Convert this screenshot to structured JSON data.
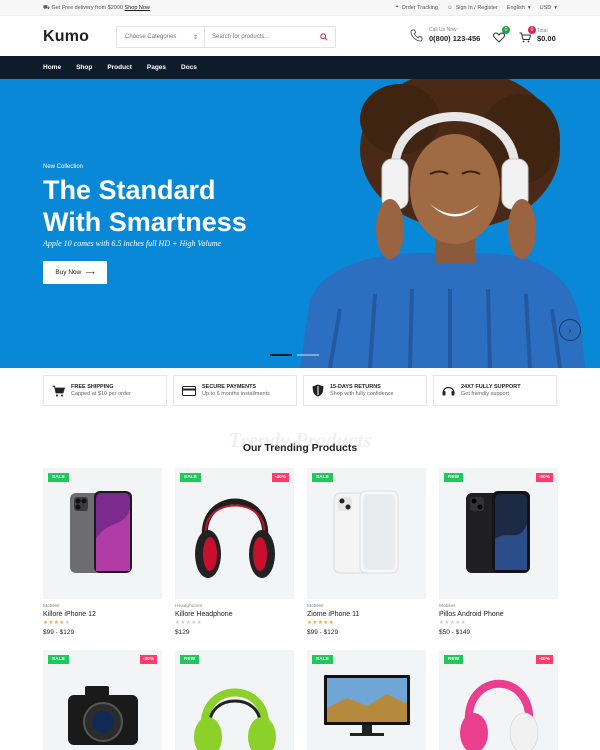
{
  "topbar": {
    "promo_text": "Get Free delivery from $2000",
    "promo_link": "Shop Now",
    "order_tracking": "Order Tracking",
    "sign_in": "Sign In / Register",
    "language": "English",
    "currency": "USD"
  },
  "header": {
    "logo": "Kumo",
    "category_select": "Choose Categories",
    "search_placeholder": "Search for products...",
    "call_label": "Call Us Now:",
    "phone": "0(800) 123-456",
    "wishlist_count": "0",
    "cart_count": "0",
    "total_label": "Total",
    "total_amount": "$0.00"
  },
  "nav": {
    "items": [
      "Home",
      "Shop",
      "Product",
      "Pages",
      "Docs"
    ]
  },
  "hero": {
    "tag": "New Collection",
    "title_line1": "The Standard",
    "title_line2": "With Smartness",
    "subtitle": "Apple 10 comes with 6.5 inches full HD + High Valume",
    "button": "Buy Now",
    "colors": {
      "background": "#0888d6"
    }
  },
  "features": [
    {
      "title": "FREE SHIPPING",
      "desc": "Capped at $10 per order",
      "icon": "cart-icon"
    },
    {
      "title": "SECURE PAYMENTS",
      "desc": "Up to 6 months installments",
      "icon": "card-icon"
    },
    {
      "title": "15-DAYS RETURNS",
      "desc": "Shop with fully confidence",
      "icon": "shield-icon"
    },
    {
      "title": "24X7 FULLY SUPPORT",
      "desc": "Get friendly support",
      "icon": "headset-icon"
    }
  ],
  "trending": {
    "ghost": "Trendy Products",
    "title": "Our Trending Products"
  },
  "products": [
    {
      "label": "SALE",
      "discount": "",
      "category": "Mobiles",
      "name": "Killore iPhone 12",
      "rating": 4,
      "price": "$99 - $129"
    },
    {
      "label": "SALE",
      "discount": "-40%",
      "category": "Headphones",
      "name": "Killore Headphone",
      "rating": 0,
      "price": "$129"
    },
    {
      "label": "SALE",
      "discount": "",
      "category": "Mobiles",
      "name": "Ziome iPhone 11",
      "rating": 5,
      "price": "$99 - $129"
    },
    {
      "label": "NEW",
      "discount": "-50%",
      "category": "Mobiles",
      "name": "Pillos Android Phone",
      "rating": 0,
      "price": "$50 - $149"
    }
  ],
  "products_row2": [
    {
      "label": "SALE",
      "discount": "-30%"
    },
    {
      "label": "NEW",
      "discount": ""
    },
    {
      "label": "SALE",
      "discount": ""
    },
    {
      "label": "NEW",
      "discount": "-60%"
    }
  ],
  "colors": {
    "accent": "#e4204d",
    "nav": "#0d1b2a",
    "badge_green": "#1ec85a",
    "badge_pink": "#ff3b6b"
  }
}
